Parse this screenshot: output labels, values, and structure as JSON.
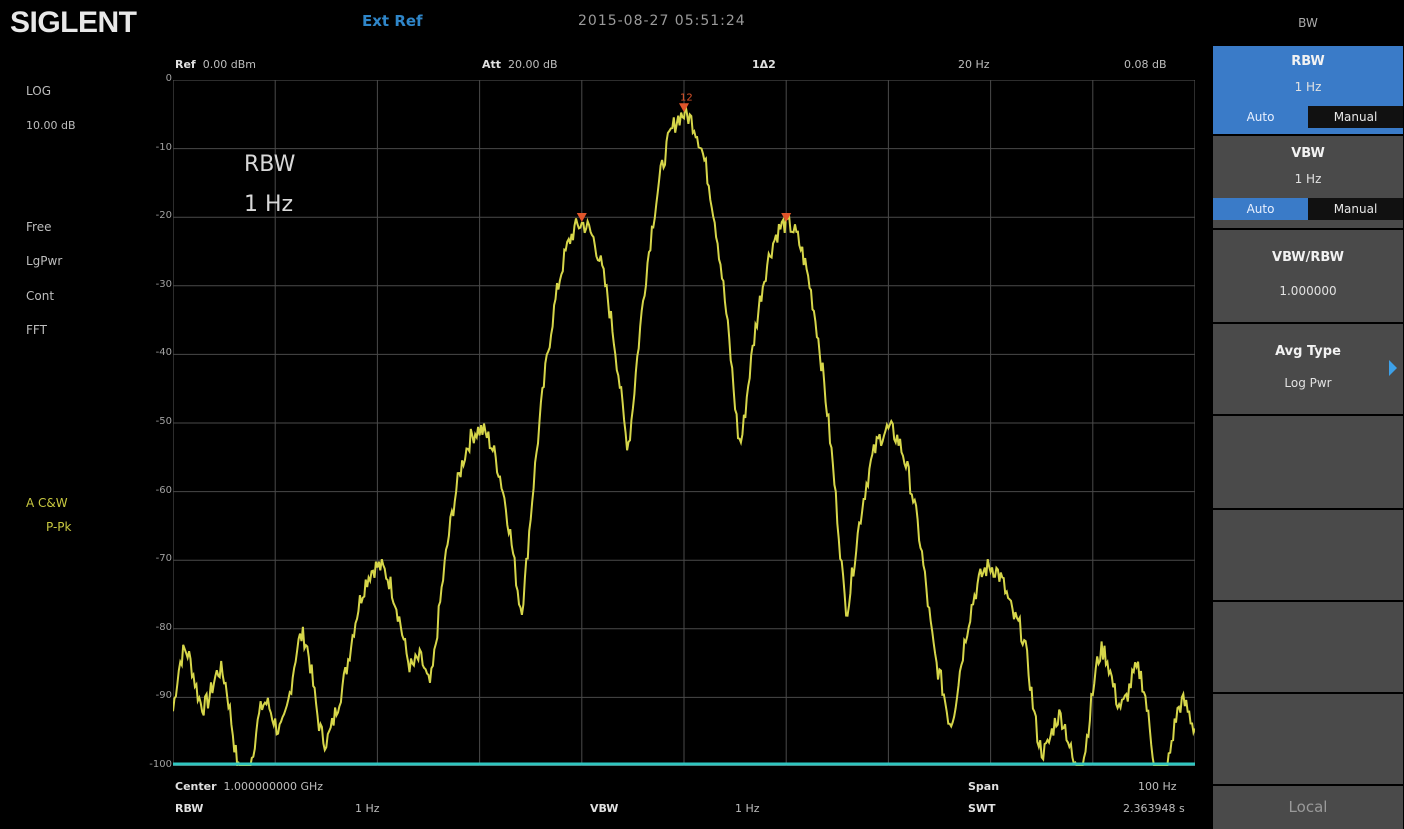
{
  "header": {
    "logo": "SIGLENT",
    "ext_ref": "Ext Ref",
    "datetime": "2015-08-27  05:51:24",
    "menu_title": "BW"
  },
  "trace_header": {
    "ref_label": "Ref",
    "ref_value": "0.00 dBm",
    "att_label": "Att",
    "att_value": "20.00 dB",
    "marker_label": "1Δ2",
    "marker_freq": "20  Hz",
    "marker_level": "0.08 dB"
  },
  "left_panel": {
    "scale_mode": "LOG",
    "scale_div": "10.00 dB",
    "trigger": "Free",
    "avg_type": "LgPwr",
    "sweep_mode": "Cont",
    "sweep_type": "FFT",
    "trace_label": "A  C&W",
    "detector": "P-Pk"
  },
  "overlay": {
    "rbw_label": "RBW",
    "rbw_value": "1   Hz"
  },
  "y_ticks": [
    "0",
    "-10",
    "-20",
    "-30",
    "-40",
    "-50",
    "-60",
    "-70",
    "-80",
    "-90",
    "-100"
  ],
  "markers": {
    "m1": "1",
    "m2": "2"
  },
  "footer": {
    "center_label": "Center",
    "center_value": "1.000000000  GHz",
    "span_label": "Span",
    "span_value": "100  Hz",
    "rbw_label": "RBW",
    "rbw_value": "1   Hz",
    "vbw_label": "VBW",
    "vbw_value": "1   Hz",
    "swt_label": "SWT",
    "swt_value": "2.363948 s"
  },
  "softkeys": {
    "rbw": {
      "label": "RBW",
      "value": "1   Hz",
      "auto": "Auto",
      "manual": "Manual"
    },
    "vbw": {
      "label": "VBW",
      "value": "1   Hz",
      "auto": "Auto",
      "manual": "Manual"
    },
    "vbw_rbw": {
      "label": "VBW/RBW",
      "value": "1.000000"
    },
    "avg_type": {
      "label": "Avg Type",
      "value": "Log Pwr"
    },
    "local": "Local"
  },
  "colors": {
    "trace": "#d6d64a",
    "baseline": "#2fc6c0",
    "marker": "#e0552a",
    "selected": "#3a7bc8",
    "grid": "#4a4a4a"
  },
  "spectrum": {
    "ref_level_dbm": 0,
    "bottom_level_dbm": -100,
    "freq_offset_hz": [
      -50,
      50
    ],
    "peaks": [
      {
        "offset_hz": 0,
        "level_dbm": -5
      },
      {
        "offset_hz": -10,
        "level_dbm": -21
      },
      {
        "offset_hz": 10,
        "level_dbm": -21
      },
      {
        "offset_hz": -20,
        "level_dbm": -51
      },
      {
        "offset_hz": 20,
        "level_dbm": -51
      },
      {
        "offset_hz": -30,
        "level_dbm": -71
      },
      {
        "offset_hz": 30,
        "level_dbm": -71
      }
    ]
  }
}
